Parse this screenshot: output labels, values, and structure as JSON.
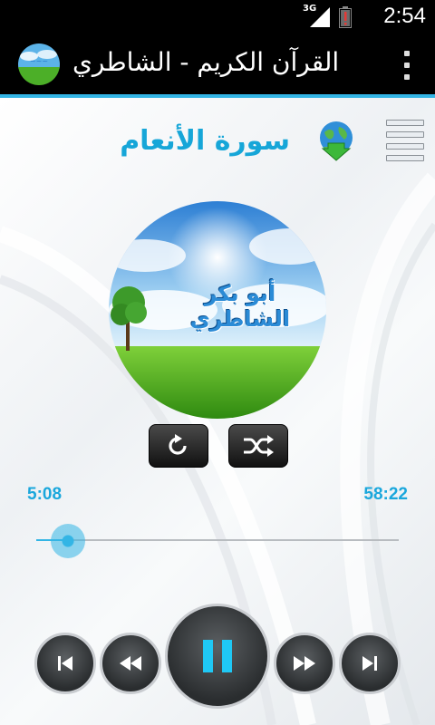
{
  "status_bar": {
    "time": "2:54",
    "network": "3G",
    "icons": [
      "signal-icon",
      "battery-low-icon"
    ]
  },
  "action_bar": {
    "title": "القرآن الكريم - الشاطري",
    "logo": "app-logo-icon",
    "overflow_icon": "overflow-menu-icon"
  },
  "player": {
    "surah_title": "سورة الأنعام",
    "download_icon": "globe-download-icon",
    "playlist_icon": "playlist-menu-icon",
    "artwork_text": "أبو بكر الشاطري",
    "repeat_icon": "repeat-icon",
    "shuffle_icon": "shuffle-icon",
    "elapsed": "5:08",
    "duration": "58:22",
    "progress_fraction": 0.088,
    "controls": [
      "skip-previous-icon",
      "rewind-icon",
      "pause-icon",
      "fast-forward-icon",
      "skip-next-icon"
    ]
  },
  "colors": {
    "accent": "#33b5e5",
    "title_blue": "#16a6d8",
    "pause_cyan": "#1fc8f5",
    "action_bar_bg": "#000000"
  }
}
